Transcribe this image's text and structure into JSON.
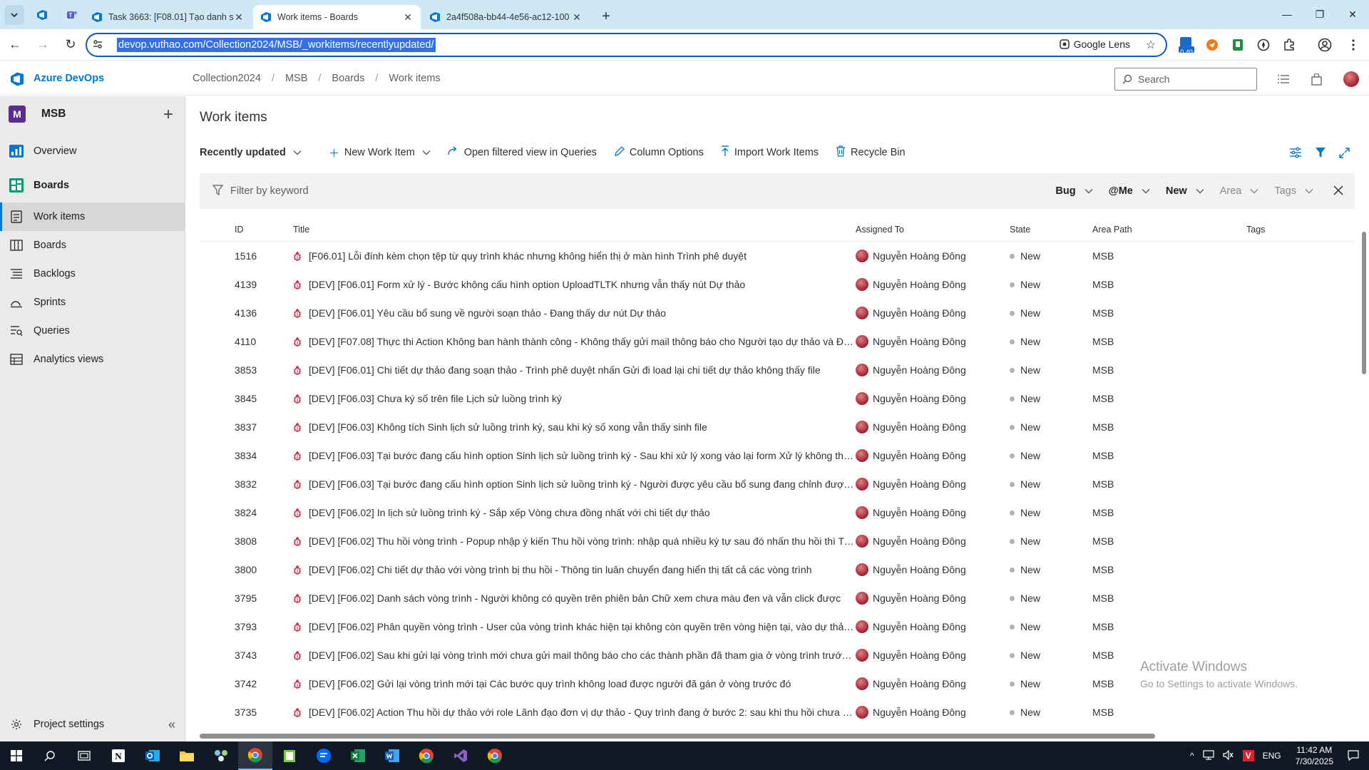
{
  "browser": {
    "tabs": [
      {
        "title": "Task 3663: [F08.01] Tạo danh sá",
        "active": false
      },
      {
        "title": "Work items - Boards",
        "active": true
      },
      {
        "title": "2a4f508a-bb44-4e56-ac12-100",
        "active": false
      }
    ],
    "url": "devop.vuthao.com/Collection2024/MSB/_workitems/recentlyupdated/",
    "lens_label": "Google Lens",
    "extension_badge": "0.40"
  },
  "header": {
    "brand": "Azure DevOps",
    "breadcrumbs": [
      "Collection2024",
      "MSB",
      "Boards",
      "Work items"
    ],
    "search_placeholder": "Search"
  },
  "sidebar": {
    "project_initial": "M",
    "project_name": "MSB",
    "items": [
      {
        "label": "Overview",
        "icon": "overview-icon"
      },
      {
        "label": "Boards",
        "icon": "boards-icon"
      },
      {
        "label": "Work items",
        "icon": "work-items-icon",
        "selected": true
      },
      {
        "label": "Boards",
        "icon": "board-icon"
      },
      {
        "label": "Backlogs",
        "icon": "backlogs-icon"
      },
      {
        "label": "Sprints",
        "icon": "sprints-icon"
      },
      {
        "label": "Queries",
        "icon": "queries-icon"
      },
      {
        "label": "Analytics views",
        "icon": "analytics-icon"
      }
    ],
    "settings_label": "Project settings"
  },
  "main": {
    "title": "Work items",
    "toolbar": {
      "view": "Recently updated",
      "new_item": "New Work Item",
      "open_queries": "Open filtered view in Queries",
      "column_options": "Column Options",
      "import": "Import Work Items",
      "recycle": "Recycle Bin"
    },
    "filter": {
      "placeholder": "Filter by keyword",
      "type": "Bug",
      "assigned": "@Me",
      "state": "New",
      "area": "Area",
      "tags": "Tags"
    },
    "columns": {
      "id": "ID",
      "title": "Title",
      "assigned": "Assigned To",
      "state": "State",
      "area": "Area Path",
      "tags": "Tags"
    },
    "rows": [
      {
        "id": "1516",
        "title": "[F06.01] Lỗi đính kèm chọn tệp từ quy trình khác nhưng không hiển thị ở màn hình Trình phê duyệt",
        "assigned": "Nguyễn Hoàng Đông",
        "state": "New",
        "area": "MSB"
      },
      {
        "id": "4139",
        "title": "[DEV] [F06.01] Form xử lý - Bước không cấu hình option UploadTLTK nhưng vẫn thấy nút Dự thảo",
        "assigned": "Nguyễn Hoàng Đông",
        "state": "New",
        "area": "MSB"
      },
      {
        "id": "4136",
        "title": "[DEV] [F06.01] Yêu cầu bổ sung về người soạn thảo - Đang thấy dư nút Dự thảo",
        "assigned": "Nguyễn Hoàng Đông",
        "state": "New",
        "area": "MSB"
      },
      {
        "id": "4110",
        "title": "[DEV] [F07.08] Thực thi Action Không ban hành thành công - Không thấy gửi mail thông báo cho Người tạo dự thảo và Đầu ...",
        "assigned": "Nguyễn Hoàng Đông",
        "state": "New",
        "area": "MSB"
      },
      {
        "id": "3853",
        "title": "[DEV] [F06.01] Chi tiết dự thảo đang soạn thảo - Trình phê duyệt nhấn Gửi đi load lại chi tiết dự thảo không thấy file",
        "assigned": "Nguyễn Hoàng Đông",
        "state": "New",
        "area": "MSB"
      },
      {
        "id": "3845",
        "title": "[DEV] [F06.03] Chưa ký số trên file Lịch sử luồng trình ký",
        "assigned": "Nguyễn Hoàng Đông",
        "state": "New",
        "area": "MSB"
      },
      {
        "id": "3837",
        "title": "[DEV] [F06.03] Không tích Sinh lịch sử luồng trình ký, sau khi ký số xong vẫn thấy sinh file",
        "assigned": "Nguyễn Hoàng Đông",
        "state": "New",
        "area": "MSB"
      },
      {
        "id": "3834",
        "title": "[DEV] [F06.03] Tại bước đang cấu hình option Sinh lịch sử luồng trình ký - Sau khi xử lý xong vào lại form Xử lý không thấy o...",
        "assigned": "Nguyễn Hoàng Đông",
        "state": "New",
        "area": "MSB"
      },
      {
        "id": "3832",
        "title": "[DEV] [F06.03] Tại bước đang cấu hình option Sinh lịch sử luồng trình ký - Người được yêu cầu bổ sung đang chỉnh được Op...",
        "assigned": "Nguyễn Hoàng Đông",
        "state": "New",
        "area": "MSB"
      },
      {
        "id": "3824",
        "title": "[DEV] [F06.02] In lịch sử luồng trình ký - Sắp xếp Vòng chưa đồng nhất với chi tiết dự thảo",
        "assigned": "Nguyễn Hoàng Đông",
        "state": "New",
        "area": "MSB"
      },
      {
        "id": "3808",
        "title": "[DEV] [F06.02] Thu hồi vòng trình - Popup nhập ý kiến Thu hồi vòng trình: nhập quá nhiều ký tự sau đó nhấn thu hồi thì Trạn...",
        "assigned": "Nguyễn Hoàng Đông",
        "state": "New",
        "area": "MSB"
      },
      {
        "id": "3800",
        "title": "[DEV] [F06.02] Chi tiết dự thảo với vòng trình bị thu hồi - Thông tin luân chuyển đang hiển thị tất cả các vòng trình",
        "assigned": "Nguyễn Hoàng Đông",
        "state": "New",
        "area": "MSB"
      },
      {
        "id": "3795",
        "title": "[DEV] [F06.02] Danh sách vòng trình - Người không có quyền trên phiên bản Chữ xem chưa màu đen và vẫn click được",
        "assigned": "Nguyễn Hoàng Đông",
        "state": "New",
        "area": "MSB"
      },
      {
        "id": "3793",
        "title": "[DEV] [F06.02] Phân quyền vòng trình - User của vòng trình khác hiện tại không còn quyền trên vòng hiện tại, vào dự thảo hi...",
        "assigned": "Nguyễn Hoàng Đông",
        "state": "New",
        "area": "MSB"
      },
      {
        "id": "3743",
        "title": "[DEV] [F06.02] Sau khi gửi lại vòng trình mới chưa gửi mail thông báo cho các thành phần đã tham gia ở vòng trình trước đó",
        "assigned": "Nguyễn Hoàng Đông",
        "state": "New",
        "area": "MSB"
      },
      {
        "id": "3742",
        "title": "[DEV] [F06.02] Gửi lại vòng trình mới tại Các bước quy trình không load được người đã gán ở vòng trước đó",
        "assigned": "Nguyễn Hoàng Đông",
        "state": "New",
        "area": "MSB"
      },
      {
        "id": "3735",
        "title": "[DEV] [F06.02] Action Thu hồi dự thảo với role Lãnh đạo đơn vị dự thảo - Quy trình đang ở bước 2: sau khi thu hồi chưa đún...",
        "assigned": "Nguyễn Hoàng Đông",
        "state": "New",
        "area": "MSB"
      }
    ]
  },
  "watermark": {
    "line1": "Activate Windows",
    "line2": "Go to Settings to activate Windows."
  },
  "taskbar": {
    "lang": "ENG",
    "time": "11:42 AM",
    "date": "7/30/2025"
  },
  "colors": {
    "accent": "#0078d4",
    "bug": "#cc293d",
    "project": "#5c2d91"
  }
}
